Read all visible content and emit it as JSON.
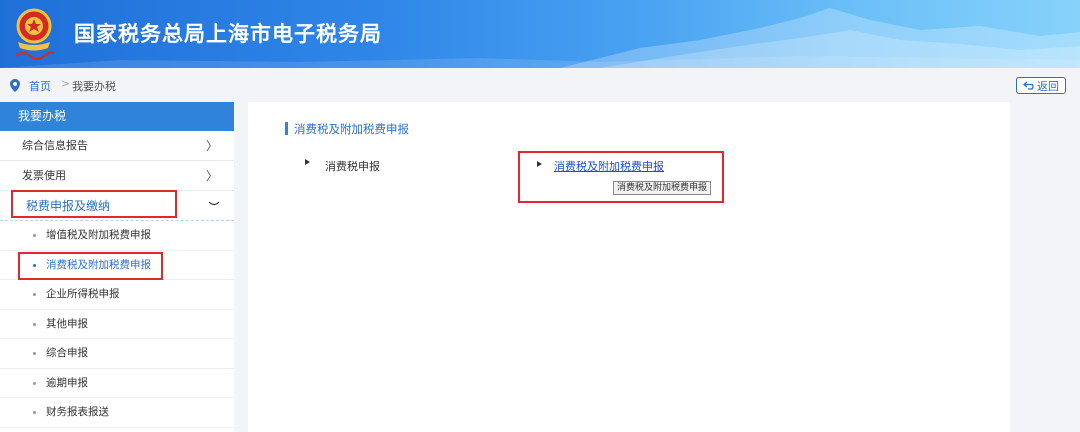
{
  "header": {
    "title": "国家税务总局上海市电子税务局"
  },
  "breadcrumb": {
    "home": "首页",
    "separator": ">",
    "current": "我要办税",
    "back_label": "返回"
  },
  "sidebar": {
    "heading": "我要办税",
    "items": [
      {
        "label": "综合信息报告",
        "arrow": "〉"
      },
      {
        "label": "发票使用",
        "arrow": "〉"
      }
    ],
    "group": {
      "label": "税费申报及缴纳",
      "expanded": true
    },
    "subitems": [
      {
        "label": "增值税及附加税费申报",
        "active": false
      },
      {
        "label": "消费税及附加税费申报",
        "active": true
      },
      {
        "label": "企业所得税申报",
        "active": false
      },
      {
        "label": "其他申报",
        "active": false
      },
      {
        "label": "综合申报",
        "active": false
      },
      {
        "label": "逾期申报",
        "active": false
      },
      {
        "label": "财务报表报送",
        "active": false
      }
    ]
  },
  "content": {
    "section_title": "消费税及附加税费申报",
    "left_item": "消费税申报",
    "right_link": "消费税及附加税费申报",
    "tooltip": "消费税及附加税费申报"
  },
  "colors": {
    "accent": "#2f83d9",
    "link": "#1a4fd8",
    "highlight_box": "#e0282e"
  }
}
